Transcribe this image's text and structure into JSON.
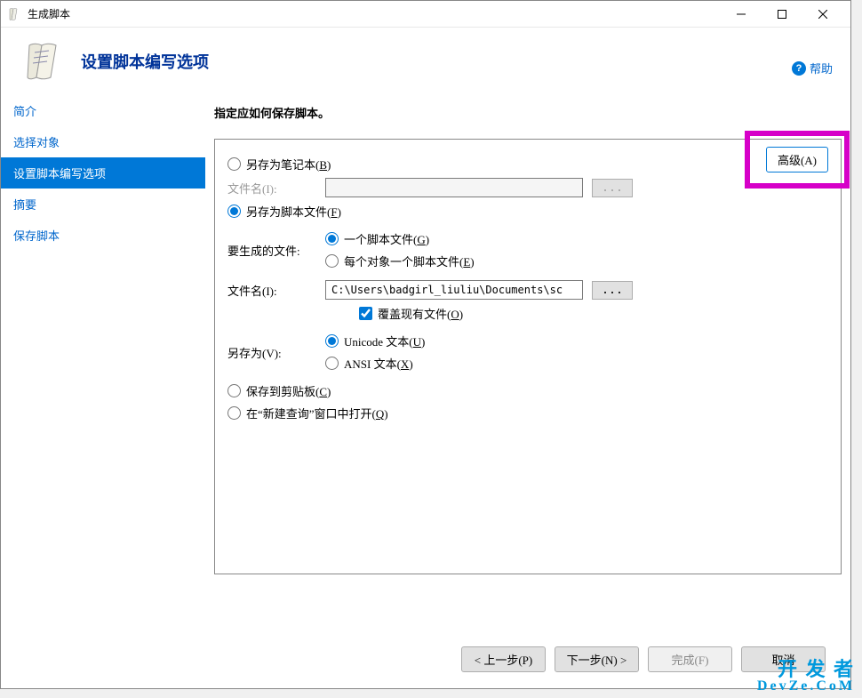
{
  "window": {
    "title": "生成脚本"
  },
  "header": {
    "title": "设置脚本编写选项"
  },
  "help": {
    "label": "帮助"
  },
  "sidebar": {
    "items": [
      {
        "label": "简介"
      },
      {
        "label": "选择对象"
      },
      {
        "label": "设置脚本编写选项"
      },
      {
        "label": "摘要"
      },
      {
        "label": "保存脚本"
      }
    ],
    "selected_index": 2
  },
  "content": {
    "instruction": "指定应如何保存脚本。",
    "advanced_button": "高级(A)",
    "options": {
      "save_as_notebook": {
        "label_prefix": "另存为笔记本(",
        "hotkey": "B",
        "label_suffix": ")",
        "checked": false
      },
      "notebook_filename_label": "文件名(I):",
      "notebook_filename_value": "",
      "save_as_script": {
        "label_prefix": "另存为脚本文件(",
        "hotkey": "F",
        "label_suffix": ")",
        "checked": true
      },
      "files_to_generate_label": "要生成的文件:",
      "single_file": {
        "label_prefix": "一个脚本文件(",
        "hotkey": "G",
        "label_suffix": ")",
        "checked": true
      },
      "per_object_file": {
        "label_prefix": "每个对象一个脚本文件(",
        "hotkey": "E",
        "label_suffix": ")",
        "checked": false
      },
      "filename_label": "文件名(I):",
      "filename_value": "C:\\Users\\badgirl_liuliu\\Documents\\sc",
      "overwrite": {
        "label_prefix": "覆盖现有文件(",
        "hotkey": "O",
        "label_suffix": ")",
        "checked": true
      },
      "save_as_label": "另存为(V):",
      "unicode": {
        "label_prefix": "Unicode 文本(",
        "hotkey": "U",
        "label_suffix": ")",
        "checked": true
      },
      "ansi": {
        "label_prefix": "ANSI 文本(",
        "hotkey": "X",
        "label_suffix": ")",
        "checked": false
      },
      "save_clipboard": {
        "label_prefix": "保存到剪贴板(",
        "hotkey": "C",
        "label_suffix": ")",
        "checked": false
      },
      "open_new_query": {
        "label_prefix": "在“新建查询”窗口中打开(",
        "hotkey": "Q",
        "label_suffix": ")",
        "checked": false
      }
    }
  },
  "footer": {
    "prev": "< 上一步(P)",
    "next": "下一步(N) >",
    "finish": "完成(F)",
    "cancel": "取消"
  },
  "watermark": {
    "line1": "开 发 者",
    "line2": "DevZe.CoM"
  },
  "browse_label": "..."
}
